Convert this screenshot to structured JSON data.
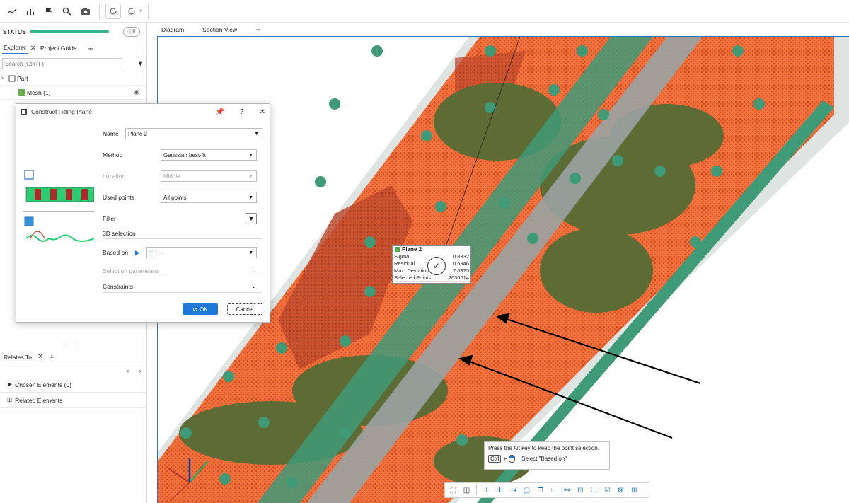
{
  "toolbar": {
    "icons": [
      "curve-icon",
      "bar-chart-icon",
      "flag-icon",
      "search-icon",
      "camera-icon",
      "refresh-icon",
      "redo-icon"
    ]
  },
  "left_panel": {
    "status_label": "STATUS",
    "status_info": "0",
    "tabs": [
      "Explorer",
      "Project Guide"
    ],
    "search_placeholder": "Search (Ctrl+F)",
    "tree": [
      {
        "label": "Part",
        "icon": "part-icon"
      },
      {
        "label": "Mesh (1)",
        "icon": "mesh-icon"
      }
    ],
    "relates_tab": "Relates To",
    "chosen_elements": "Chosen Elements (0)",
    "related_elements": "Related Elements"
  },
  "view": {
    "tabs": [
      "Diagram",
      "Section View"
    ]
  },
  "dialog": {
    "title": "Construct Fitting Plane",
    "name_label": "Name",
    "name_value": "Plane 2",
    "method_label": "Method",
    "method_value": "Gaussian best-fit",
    "location_label": "Location",
    "location_value": "Middle",
    "used_points_label": "Used points",
    "used_points_value": "All points",
    "filter_label": "Filter",
    "selection_label": "3D selection",
    "based_on_label": "Based on",
    "based_on_value": "---",
    "selection_params_label": "Selection parameters",
    "constraints_label": "Constraints",
    "ok_label": "OK",
    "cancel_label": "Cancel"
  },
  "plane_label": {
    "title": "Plane 2",
    "rows": [
      {
        "key": "Sigma",
        "value": "0.8332"
      },
      {
        "key": "Residual",
        "value": "0.6946"
      },
      {
        "key": "Max. Deviation",
        "value": "7.0825"
      },
      {
        "key": "Selected Points",
        "value": "2636614"
      }
    ]
  },
  "tooltip": {
    "line1": "Press the Alt key to keep the point selection.",
    "key": "Ctrl",
    "plus": "+",
    "action": "Select \"Based on\""
  },
  "colors": {
    "orange": "#f4703a",
    "olive": "#5d6b34",
    "teal": "#3f9a78",
    "gray_stripe": "#9aa3a3",
    "accent_blue": "#1e78d8",
    "status_green": "#35b58f"
  }
}
